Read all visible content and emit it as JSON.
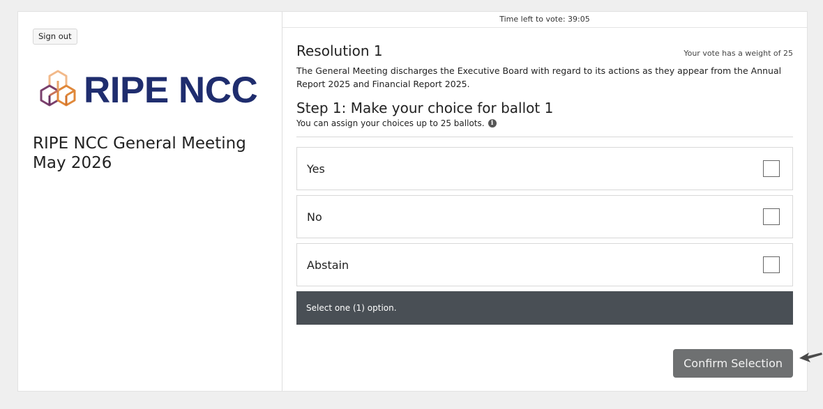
{
  "sidebar": {
    "sign_out_label": "Sign out",
    "logo_text": "RIPE NCC",
    "meeting_title": "RIPE NCC General Meeting May 2026"
  },
  "header": {
    "timer_text": "Time left to vote: 39:05"
  },
  "resolution": {
    "title": "Resolution 1",
    "weight_text": "Your vote has a weight of 25",
    "description": "The General Meeting discharges the Executive Board with regard to its actions as they appear from the Annual Report 2025 and Financial Report 2025."
  },
  "step": {
    "title": "Step 1: Make your choice for ballot 1",
    "subtitle": "You can assign your choices up to 25 ballots."
  },
  "options": [
    {
      "label": "Yes",
      "checked": false
    },
    {
      "label": "No",
      "checked": false
    },
    {
      "label": "Abstain",
      "checked": false
    }
  ],
  "notice_text": "Select one (1) option.",
  "confirm_label": "Confirm Selection",
  "colors": {
    "brand_navy": "#1f2d6e",
    "brand_orange": "#e0883a",
    "notice_bg": "#494f55",
    "confirm_bg": "#6e7071"
  },
  "icons": {
    "logo_mark": "ripe-cubes-icon",
    "info": "info-icon",
    "cursor": "cursor-arrow-icon"
  }
}
